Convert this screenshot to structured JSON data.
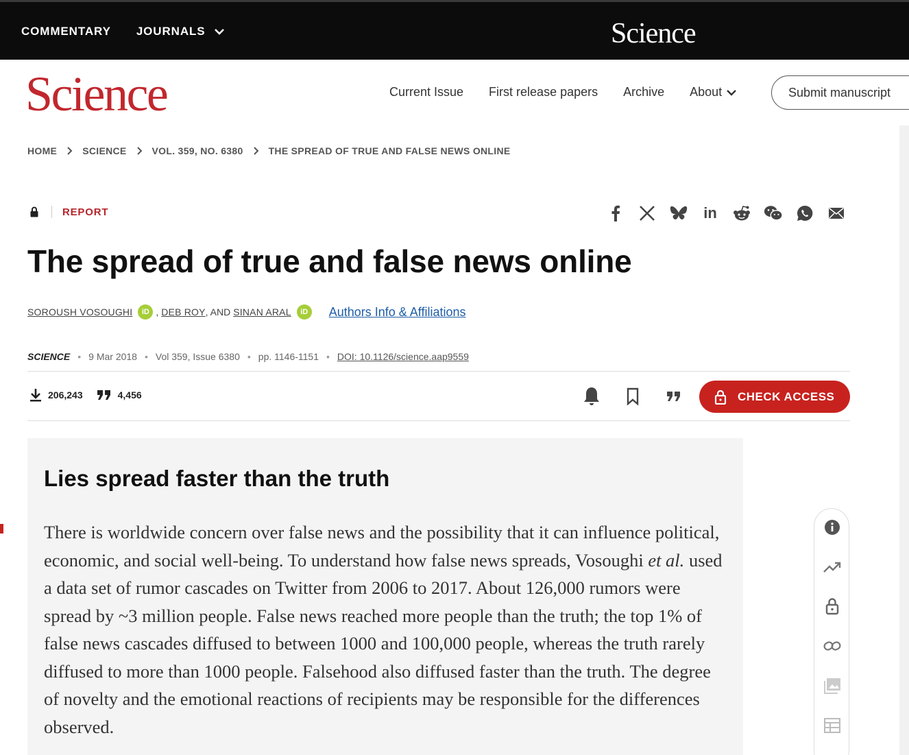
{
  "topbar": {
    "commentary": "COMMENTARY",
    "journals": "JOURNALS",
    "brand": "Science"
  },
  "header": {
    "logo": "Science",
    "nav": [
      "Current Issue",
      "First release papers",
      "Archive",
      "About"
    ],
    "submit": "Submit manuscript"
  },
  "breadcrumb": [
    "HOME",
    "SCIENCE",
    "VOL. 359, NO. 6380",
    "THE SPREAD OF TRUE AND FALSE NEWS ONLINE"
  ],
  "article": {
    "type": "REPORT",
    "title": "The spread of true and false news online",
    "authors": [
      "SOROUSH VOSOUGHI",
      "DEB ROY",
      "SINAN ARAL"
    ],
    "author_sep1": ",",
    "author_sep2": ", AND",
    "orcid": "iD",
    "affiliations": "Authors Info & Affiliations",
    "journal": "SCIENCE",
    "date": "9 Mar 2018",
    "volume": "Vol 359, Issue 6380",
    "pages": "pp. 1146-1151",
    "doi": "DOI: 10.1126/science.aap9559",
    "downloads": "206,243",
    "citations": "4,456",
    "check_access": "CHECK ACCESS"
  },
  "summary": {
    "heading": "Lies spread faster than the truth",
    "text_before_italic": "There is worldwide concern over false news and the possibility that it can influence political, economic, and social well-being. To understand how false news spreads, Vosoughi ",
    "italic": "et al.",
    "text_after_italic": " used a data set of rumor cascades on Twitter from 2006 to 2017. About 126,000 rumors were spread by ~3 million people. False news reached more people than the truth; the top 1% of false news cascades diffused to between 1000 and 100,000 people, whereas the truth rarely diffused to more than 1000 people. Falsehood also diffused faster than the truth. The degree of novelty and the emo­tional reactions of recipients may be responsible for the differences observed."
  },
  "icons": {
    "share": [
      "facebook-icon",
      "x-icon",
      "bluesky-icon",
      "linkedin-icon",
      "reddit-icon",
      "wechat-icon",
      "whatsapp-icon",
      "email-icon"
    ],
    "rail": [
      "info-icon",
      "trending-icon",
      "lock-icon",
      "link-icon",
      "image-icon",
      "table-icon"
    ]
  },
  "colors": {
    "brand_red": "#c1272d",
    "button_red": "#c8221f",
    "link_blue": "#1f5ea8",
    "orcid_green": "#a6ce39"
  }
}
